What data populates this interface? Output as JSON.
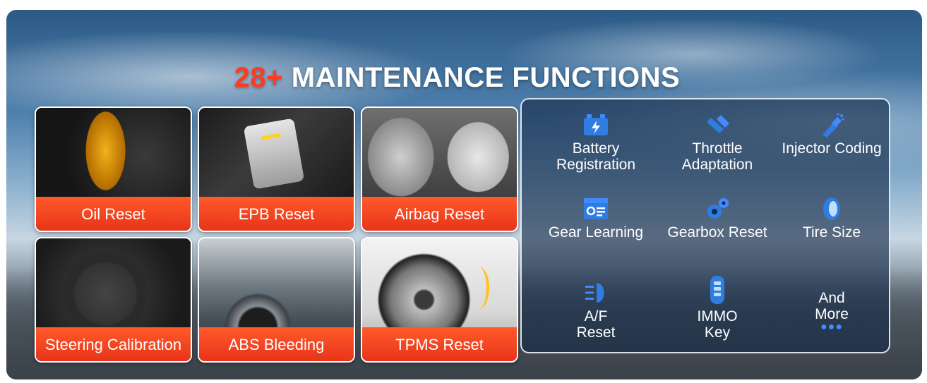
{
  "title": {
    "accent": "28+",
    "main": "MAINTENANCE FUNCTIONS"
  },
  "tiles": [
    {
      "label": "Oil Reset"
    },
    {
      "label": "EPB Reset"
    },
    {
      "label": "Airbag Reset"
    },
    {
      "label": "Steering Calibration"
    },
    {
      "label": "ABS Bleeding"
    },
    {
      "label": "TPMS Reset"
    }
  ],
  "features": [
    {
      "label": "Battery Registration",
      "icon": "battery-icon"
    },
    {
      "label": "Throttle Adaptation",
      "icon": "throttle-pedal-icon"
    },
    {
      "label": "Injector Coding",
      "icon": "injector-icon"
    },
    {
      "label": "Gear Learning",
      "icon": "gear-learning-screen-icon"
    },
    {
      "label": "Gearbox Reset",
      "icon": "gears-icon"
    },
    {
      "label": "Tire Size",
      "icon": "tire-icon"
    },
    {
      "label": "A/F Reset",
      "icon": "headlight-icon"
    },
    {
      "label": "IMMO Key",
      "icon": "car-key-icon"
    },
    {
      "label": "And More",
      "icon": "more-dots-icon"
    }
  ],
  "colors": {
    "accent": "#ff3b1f",
    "label_bg": "#e8341a",
    "icon_blue": "#3f8cff"
  }
}
